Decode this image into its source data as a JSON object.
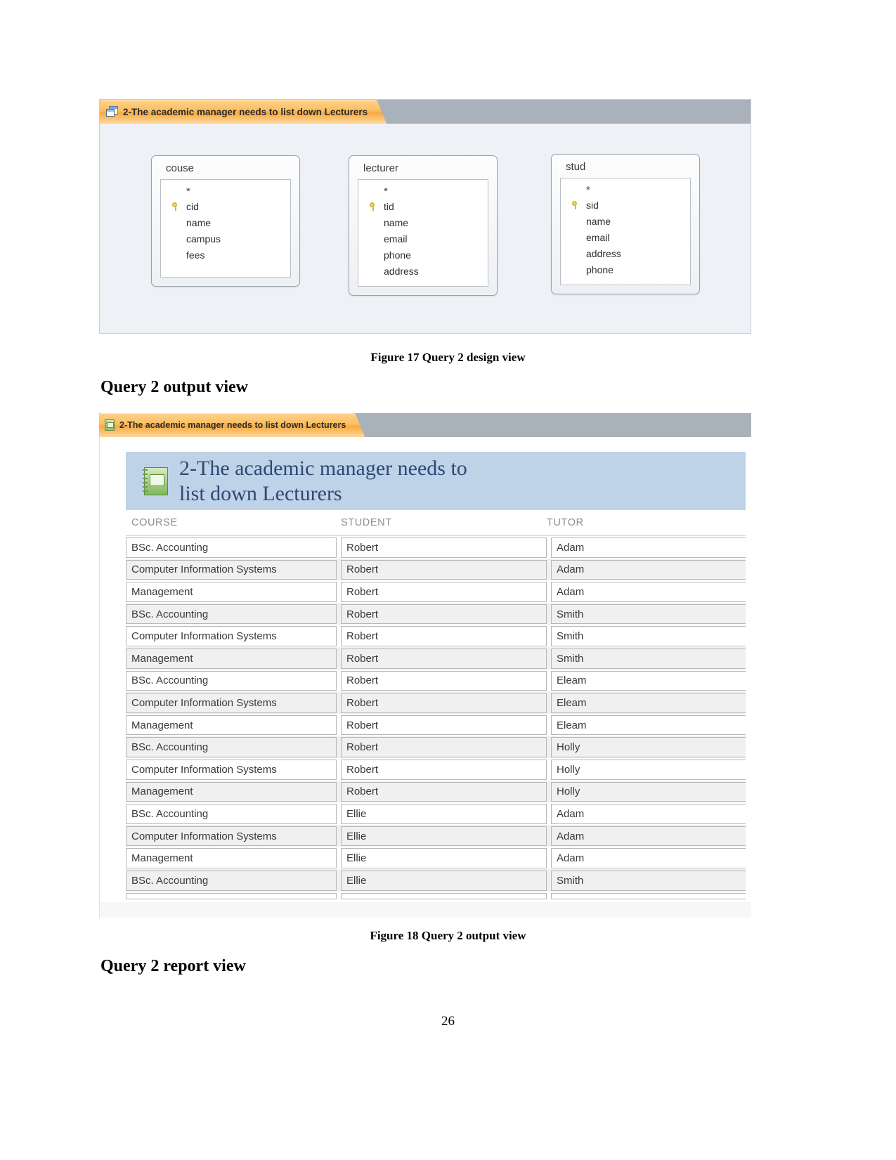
{
  "document": {
    "page_number": "26"
  },
  "figure_design": {
    "tab": {
      "icon": "query-design-icon",
      "label": "2-The academic manager needs to list down Lecturers"
    },
    "tables": [
      {
        "name": "couse",
        "star": "*",
        "fields": [
          {
            "name": "cid",
            "key": true
          },
          {
            "name": "name",
            "key": false
          },
          {
            "name": "campus",
            "key": false
          },
          {
            "name": "fees",
            "key": false
          }
        ]
      },
      {
        "name": "lecturer",
        "star": "*",
        "fields": [
          {
            "name": "tid",
            "key": true
          },
          {
            "name": "name",
            "key": false
          },
          {
            "name": "email",
            "key": false
          },
          {
            "name": "phone",
            "key": false
          },
          {
            "name": "address",
            "key": false
          }
        ]
      },
      {
        "name": "stud",
        "star": "*",
        "fields": [
          {
            "name": "sid",
            "key": true
          },
          {
            "name": "name",
            "key": false
          },
          {
            "name": "email",
            "key": false
          },
          {
            "name": "address",
            "key": false
          },
          {
            "name": "phone",
            "key": false
          }
        ]
      }
    ],
    "caption": "Figure 17 Query 2 design view"
  },
  "section_heading_output": "Query 2 output view",
  "figure_output": {
    "tab": {
      "icon": "report-icon",
      "label": "2-The academic manager needs to list down Lecturers"
    },
    "report": {
      "icon": "report-banner-icon",
      "title_line1": "2-The academic manager needs to",
      "title_line2": "list down Lecturers",
      "columns": [
        "COURSE",
        "STUDENT",
        "TUTOR"
      ],
      "rows": [
        [
          "BSc. Accounting",
          "Robert",
          "Adam"
        ],
        [
          "Computer Information Systems",
          "Robert",
          "Adam"
        ],
        [
          "Management",
          "Robert",
          "Adam"
        ],
        [
          "BSc. Accounting",
          "Robert",
          "Smith"
        ],
        [
          "Computer Information Systems",
          "Robert",
          "Smith"
        ],
        [
          "Management",
          "Robert",
          "Smith"
        ],
        [
          "BSc. Accounting",
          "Robert",
          "Eleam"
        ],
        [
          "Computer Information Systems",
          "Robert",
          "Eleam"
        ],
        [
          "Management",
          "Robert",
          "Eleam"
        ],
        [
          "BSc. Accounting",
          "Robert",
          "Holly"
        ],
        [
          "Computer Information Systems",
          "Robert",
          "Holly"
        ],
        [
          "Management",
          "Robert",
          "Holly"
        ],
        [
          "BSc. Accounting",
          "Ellie",
          "Adam"
        ],
        [
          "Computer Information Systems",
          "Ellie",
          "Adam"
        ],
        [
          "Management",
          "Ellie",
          "Adam"
        ],
        [
          "BSc. Accounting",
          "Ellie",
          "Smith"
        ]
      ]
    },
    "caption": "Figure 18 Query 2 output view"
  },
  "section_heading_report": "Query 2 report view",
  "colors": {
    "tab_active": "#f6ab42",
    "tab_bar": "#a9b1ba",
    "report_banner": "#bed2e8",
    "report_title_text": "#2b4a73",
    "row_alt": "#f0f0f0"
  }
}
